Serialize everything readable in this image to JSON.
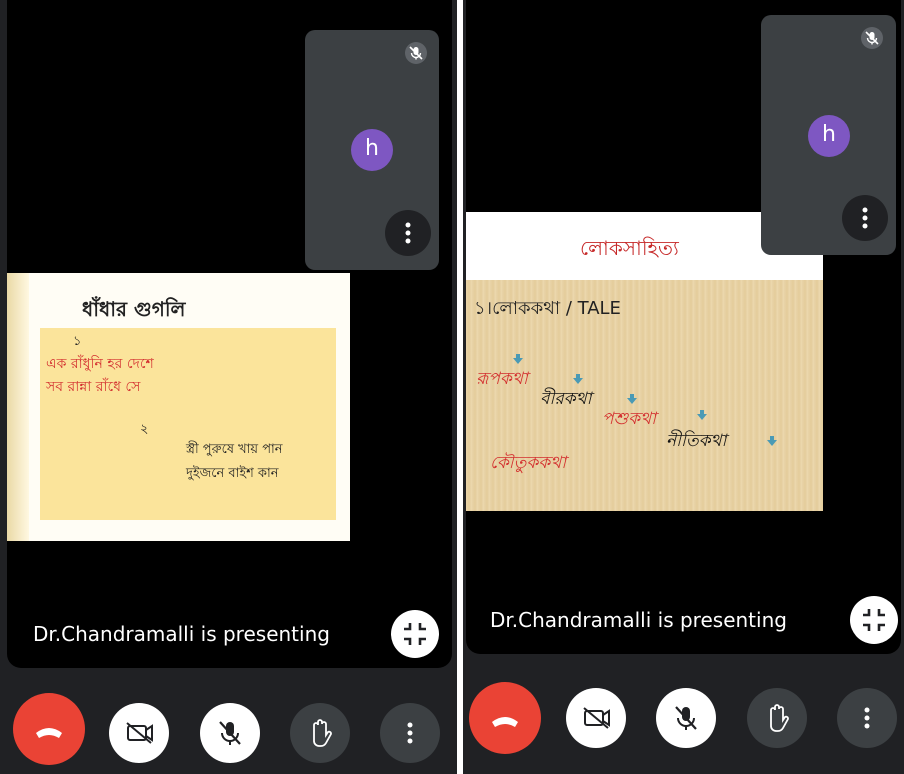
{
  "left_panel": {
    "presenting_text": "Dr.Chandramalli is presenting",
    "self_tile": {
      "avatar_letter": "h"
    },
    "slide": {
      "title": "ধাঁধার গুগলি",
      "riddle1_number": "১",
      "riddle1_line1": "এক রাঁধুনি হর দেশে",
      "riddle1_line2": "সব রান্না রাঁধে সে",
      "riddle2_number": "২",
      "riddle2_line1": "স্ত্রী পুরুষে খায় পান",
      "riddle2_line2": "দুইজনে বাইশ কান"
    }
  },
  "right_panel": {
    "presenting_text": "Dr.Chandramalli is presenting",
    "self_tile": {
      "avatar_letter": "h"
    },
    "slide": {
      "title": "লোকসাহিত্য",
      "heading": "১।লোককথা / TALE",
      "item_rupkatha": "রূপকথা",
      "item_birkatha": "বীরকথা",
      "item_pashukatha": "পশুকথা",
      "item_nitikatha": "নীতিকথা",
      "item_koutukkatha": "কৌতুককথা"
    }
  },
  "colors": {
    "end_call": "#ea4335",
    "avatar": "#7e57c2",
    "slide_red": "#d32f2f",
    "arrow": "#4a9ab5"
  }
}
